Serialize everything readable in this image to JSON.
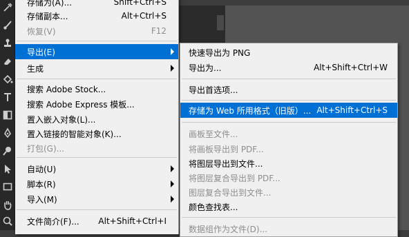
{
  "file_menu": {
    "items": [
      {
        "label": "存储为(A)...",
        "shortcut": "Shift+Ctrl+S",
        "disabled": false
      },
      {
        "label": "存储副本...",
        "shortcut": "Alt+Ctrl+S",
        "disabled": false
      },
      {
        "label": "恢复(V)",
        "shortcut": "F12",
        "disabled": true
      },
      {
        "label": "导出(E)",
        "shortcut": "",
        "disabled": false,
        "submenu": true,
        "active": true
      },
      {
        "label": "生成",
        "shortcut": "",
        "disabled": false,
        "submenu": true
      },
      {
        "label": "搜索 Adobe Stock...",
        "shortcut": "",
        "disabled": false
      },
      {
        "label": "搜索 Adobe Express 模板...",
        "shortcut": "",
        "disabled": false
      },
      {
        "label": "置入嵌入对象(L)...",
        "shortcut": "",
        "disabled": false
      },
      {
        "label": "置入链接的智能对象(K)...",
        "shortcut": "",
        "disabled": false
      },
      {
        "label": "打包(G)...",
        "shortcut": "",
        "disabled": true
      },
      {
        "label": "自动(U)",
        "shortcut": "",
        "disabled": false,
        "submenu": true
      },
      {
        "label": "脚本(R)",
        "shortcut": "",
        "disabled": false,
        "submenu": true
      },
      {
        "label": "导入(M)",
        "shortcut": "",
        "disabled": false,
        "submenu": true
      },
      {
        "label": "文件简介(F)...",
        "shortcut": "Alt+Shift+Ctrl+I",
        "disabled": false
      }
    ]
  },
  "export_submenu": {
    "items": [
      {
        "label": "快速导出为 PNG",
        "shortcut": "",
        "disabled": false
      },
      {
        "label": "导出为...",
        "shortcut": "Alt+Shift+Ctrl+W",
        "disabled": false
      },
      {
        "label": "导出首选项...",
        "shortcut": "",
        "disabled": false
      },
      {
        "label": "存储为 Web 所用格式（旧版）...",
        "shortcut": "Alt+Shift+Ctrl+S",
        "disabled": false,
        "highlight": true
      },
      {
        "label": "画板至文件...",
        "shortcut": "",
        "disabled": true
      },
      {
        "label": "将画板导出到 PDF...",
        "shortcut": "",
        "disabled": true
      },
      {
        "label": "将图层导出到文件...",
        "shortcut": "",
        "disabled": false
      },
      {
        "label": "将图层复合导出到 PDF...",
        "shortcut": "",
        "disabled": true
      },
      {
        "label": "图层复合导出到文件...",
        "shortcut": "",
        "disabled": true
      },
      {
        "label": "颜色查找表...",
        "shortcut": "",
        "disabled": false
      },
      {
        "label": "数据组作为文件(D)...",
        "shortcut": "",
        "disabled": true
      }
    ]
  },
  "toolbar": {
    "tools": [
      "eyedropper-icon",
      "brush-icon",
      "stamp-icon",
      "eraser-icon",
      "paint-bucket-icon",
      "pen-tool-icon",
      "type-tool-icon",
      "path-selection-icon",
      "rectangle-icon",
      "hand-icon",
      "zoom-icon"
    ]
  },
  "colors": {
    "menu_bg": "#f0f0f0",
    "highlight": "#0070d4",
    "disabled_text": "#8d8d8d",
    "toolbar_bg": "#282828"
  }
}
